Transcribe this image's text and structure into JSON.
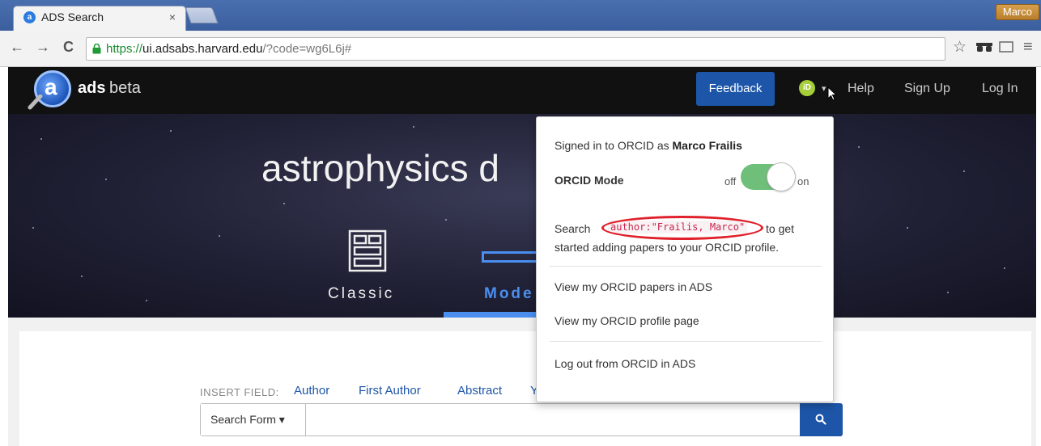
{
  "browser": {
    "tab_title": "ADS Search",
    "tab_close": "×",
    "profile_name": "Marco",
    "url_scheme": "https://",
    "url_host": "ui.adsabs.harvard.edu",
    "url_rest": "/?code=wg6L6j#",
    "back": "←",
    "forward": "→",
    "reload": "C",
    "star": "☆",
    "menu": "≡"
  },
  "navbar": {
    "logo_letter": "a",
    "logo_ads": "ads",
    "logo_beta": "beta",
    "feedback_label": "Feedback",
    "orcid_badge": "iD",
    "caret": "▾",
    "help": "Help",
    "sign_up": "Sign Up",
    "log_in": "Log In"
  },
  "hero": {
    "title": "astrophysics d",
    "classic": "Classic",
    "modern": "Mode"
  },
  "search": {
    "insert_field": "INSERT FIELD:",
    "fields": [
      "Author",
      "First Author",
      "Abstract",
      "Y"
    ],
    "form_button": "Search Form ▾",
    "input_value": "",
    "accent": "#1d56a8"
  },
  "orcid_dropdown": {
    "signed_in_prefix": "Signed in to ORCID as ",
    "user_name": "Marco Frailis",
    "mode_label": "ORCID Mode",
    "toggle_off": "off",
    "toggle_on": "on",
    "toggle_state": "on",
    "search_prefix": "Search ",
    "query": "author:\"Frailis, Marco\"",
    "search_suffix": " to get",
    "search_line2": "started adding papers to your ORCID profile.",
    "view_papers": "View my ORCID papers in ADS",
    "view_profile": "View my ORCID profile page",
    "log_out": "Log out from ORCID in ADS",
    "highlight_color": "#e0202a"
  }
}
